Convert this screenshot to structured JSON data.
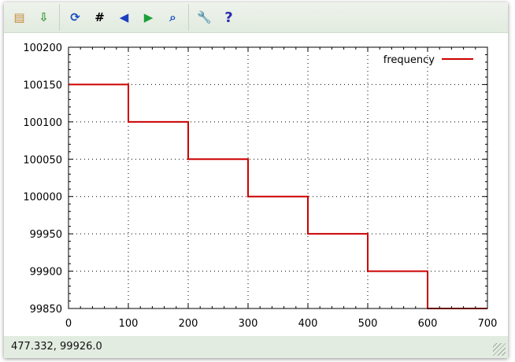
{
  "toolbar": {
    "items": [
      {
        "name": "copy-clipboard",
        "glyph": "📋"
      },
      {
        "name": "export-plot",
        "glyph": "⇩"
      },
      {
        "name": "replot",
        "glyph": "⟳"
      },
      {
        "name": "toggle-grid",
        "glyph": "#"
      },
      {
        "name": "previous-zoom",
        "glyph": "◀"
      },
      {
        "name": "next-zoom",
        "glyph": "▶"
      },
      {
        "name": "autoscale",
        "glyph": "⌕"
      },
      {
        "name": "configuration",
        "glyph": "🔧"
      },
      {
        "name": "help",
        "glyph": "?"
      }
    ]
  },
  "status": {
    "text": "477.332,  99926.0"
  },
  "chart_data": {
    "type": "line",
    "title": "",
    "xlabel": "",
    "ylabel": "",
    "xlim": [
      0,
      700
    ],
    "ylim": [
      99850,
      100200
    ],
    "xticks": [
      0,
      100,
      200,
      300,
      400,
      500,
      600,
      700
    ],
    "yticks": [
      99850,
      99900,
      99950,
      100000,
      100050,
      100100,
      100150,
      100200
    ],
    "grid": true,
    "legend": "top-right",
    "series": [
      {
        "name": "frequency",
        "color": "#cc0000",
        "step": true,
        "x": [
          0,
          100,
          200,
          300,
          400,
          500,
          600,
          700
        ],
        "y": [
          100150,
          100100,
          100050,
          100000,
          99950,
          99900,
          99850,
          99850
        ]
      }
    ]
  }
}
